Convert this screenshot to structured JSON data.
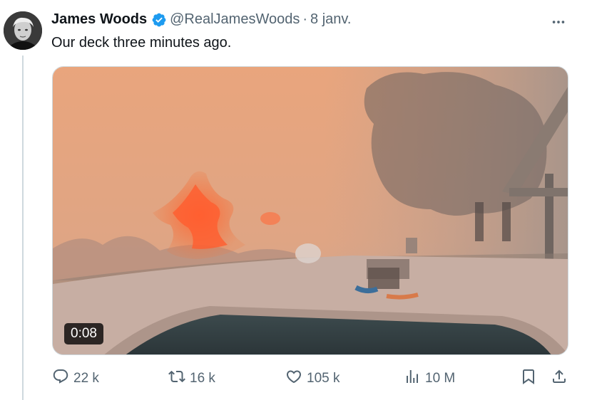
{
  "tweet": {
    "author_name": "James Woods",
    "handle": "@RealJamesWoods",
    "separator": "·",
    "date": "8 janv.",
    "text": "Our deck three minutes ago.",
    "more_icon": "more-horizontal-icon",
    "verified_icon": "verified-badge-icon"
  },
  "media": {
    "type": "video",
    "timestamp": "0:08"
  },
  "actions": {
    "replies": "22 k",
    "reposts": "16 k",
    "likes": "105 k",
    "views": "10 M",
    "icons": [
      "reply-icon",
      "repost-icon",
      "like-icon",
      "views-icon",
      "bookmark-icon",
      "share-icon"
    ]
  },
  "colors": {
    "verified_blue": "#1d9bf0",
    "text_primary": "#0f1419",
    "text_secondary": "#536471",
    "thread_line": "#cfd9de"
  }
}
